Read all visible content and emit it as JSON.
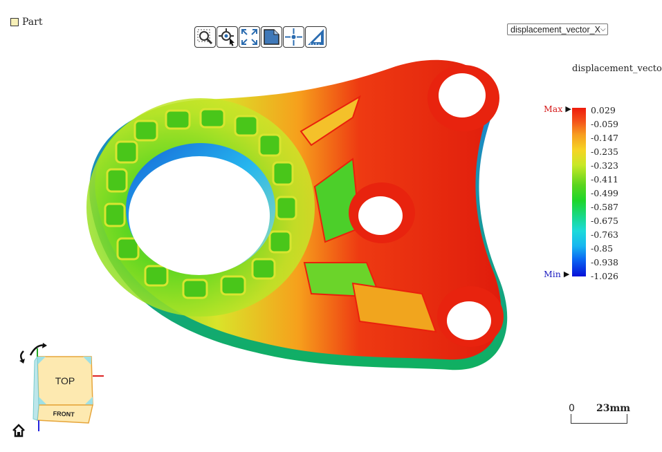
{
  "part_toggle": {
    "label": "Part",
    "checked": false
  },
  "toolbar": {
    "buttons": [
      {
        "icon": "zoom-box-icon"
      },
      {
        "icon": "pick-point-icon"
      },
      {
        "icon": "fit-view-icon"
      },
      {
        "icon": "section-view-icon"
      },
      {
        "icon": "crosshair-icon"
      },
      {
        "icon": "measure-icon"
      }
    ]
  },
  "field_select": {
    "value": "displacement_vector_X"
  },
  "legend": {
    "title": "displacement_vector_X",
    "max_label": "Max",
    "min_label": "Min",
    "values": [
      "0.029",
      "-0.059",
      "-0.147",
      "-0.235",
      "-0.323",
      "-0.411",
      "-0.499",
      "-0.587",
      "-0.675",
      "-0.763",
      "-0.85",
      "-0.938",
      "-1.026"
    ],
    "max_color": "#d51818",
    "min_color": "#1c1cc0"
  },
  "scalebar": {
    "zero": "0",
    "length": "23mm"
  },
  "view_cube": {
    "top_face": "TOP",
    "front_face": "FRONT"
  }
}
